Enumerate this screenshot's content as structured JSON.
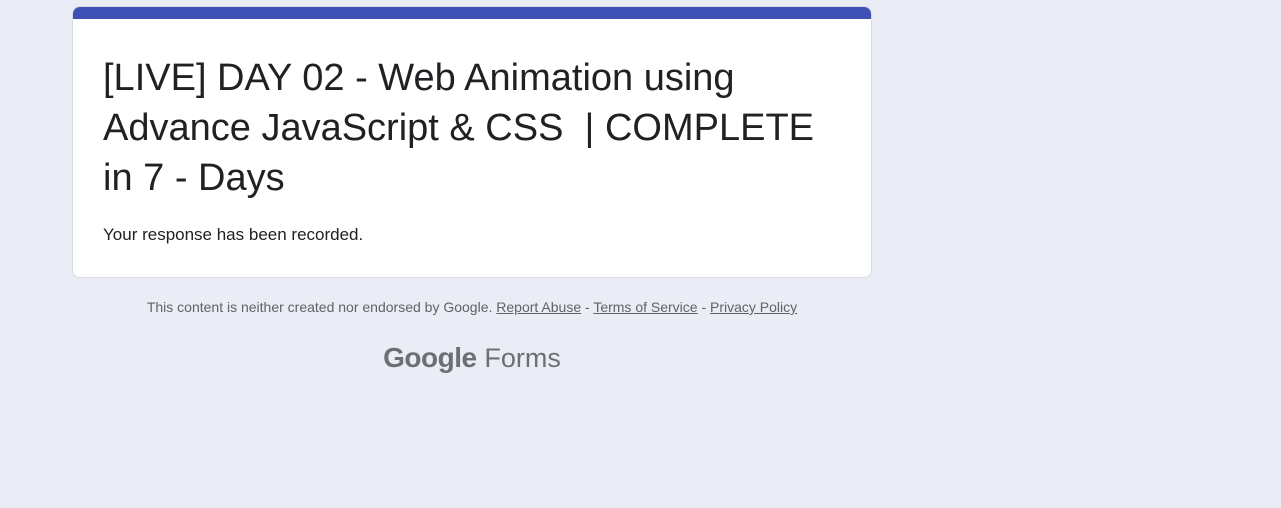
{
  "form": {
    "title": "[LIVE] DAY 02 - Web Animation using Advance JavaScript & CSS  | COMPLETE in 7 - Days",
    "confirmation_message": "Your response has been recorded.",
    "accent_color": "#3f51b5"
  },
  "footer": {
    "disclaimer": "This content is neither created nor endorsed by Google.",
    "report_abuse": "Report Abuse",
    "separator": "-",
    "terms": "Terms of Service",
    "privacy": "Privacy Policy"
  },
  "branding": {
    "google": "Google",
    "product": "Forms"
  },
  "colors": {
    "page_background": "#ebedf6",
    "text": "#202124",
    "muted_text": "#5f6368"
  }
}
